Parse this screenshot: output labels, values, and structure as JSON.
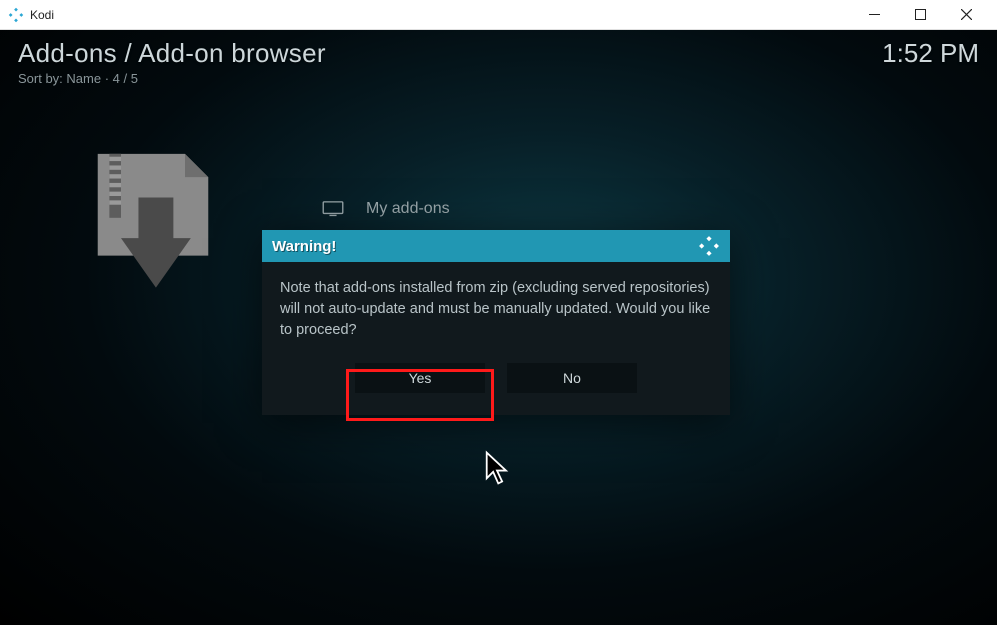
{
  "titlebar": {
    "app_name": "Kodi"
  },
  "header": {
    "breadcrumb": "Add-ons / Add-on browser",
    "sort_label": "Sort by: Name",
    "position": "4 / 5",
    "clock": "1:52 PM"
  },
  "list": {
    "visible_item_label": "My add-ons"
  },
  "dialog": {
    "title": "Warning!",
    "message": "Note that add-ons installed from zip (excluding served repositories) will not auto-update and must be manually updated. Would you like to proceed?",
    "yes_label": "Yes",
    "no_label": "No"
  }
}
